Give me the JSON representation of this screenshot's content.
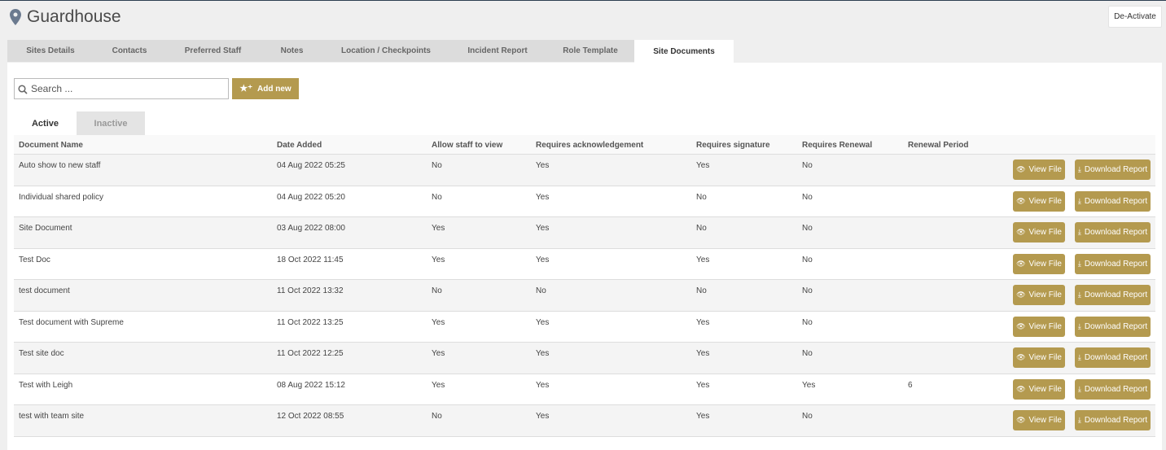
{
  "header": {
    "title": "Guardhouse",
    "deactivate_label": "De-Activate"
  },
  "tabs": [
    {
      "label": "Sites Details"
    },
    {
      "label": "Contacts"
    },
    {
      "label": "Preferred Staff"
    },
    {
      "label": "Notes"
    },
    {
      "label": "Location / Checkpoints"
    },
    {
      "label": "Incident Report"
    },
    {
      "label": "Role Template"
    },
    {
      "label": "Site Documents",
      "active": true
    }
  ],
  "toolbar": {
    "search_placeholder": "Search ...",
    "add_label": "Add new"
  },
  "subtabs": [
    {
      "label": "Active",
      "active": true
    },
    {
      "label": "Inactive"
    }
  ],
  "table": {
    "headers": [
      "Document Name",
      "Date Added",
      "Allow staff to view",
      "Requires acknowledgement",
      "Requires signature",
      "Requires Renewal",
      "Renewal Period"
    ],
    "view_label": "View File",
    "download_label": "Download Report",
    "rows": [
      [
        "Auto show to new staff",
        "04 Aug 2022 05:25",
        "No",
        "Yes",
        "Yes",
        "No",
        ""
      ],
      [
        "Individual shared policy",
        "04 Aug 2022 05:20",
        "No",
        "Yes",
        "No",
        "No",
        ""
      ],
      [
        "Site Document",
        "03 Aug 2022 08:00",
        "Yes",
        "Yes",
        "No",
        "No",
        ""
      ],
      [
        "Test Doc",
        "18 Oct 2022 11:45",
        "Yes",
        "Yes",
        "Yes",
        "No",
        ""
      ],
      [
        "test document",
        "11 Oct 2022 13:32",
        "No",
        "No",
        "No",
        "No",
        ""
      ],
      [
        "Test document with Supreme",
        "11 Oct 2022 13:25",
        "Yes",
        "Yes",
        "Yes",
        "No",
        ""
      ],
      [
        "Test site doc",
        "11 Oct 2022 12:25",
        "Yes",
        "Yes",
        "Yes",
        "No",
        ""
      ],
      [
        "Test with Leigh",
        "08 Aug 2022 15:12",
        "Yes",
        "Yes",
        "Yes",
        "Yes",
        "6"
      ],
      [
        "test with team site",
        "12 Oct 2022 08:55",
        "No",
        "Yes",
        "Yes",
        "No",
        ""
      ]
    ]
  },
  "colors": {
    "accent": "#b49a4f",
    "background": "#efefef",
    "pin": "#6b7a8f"
  }
}
